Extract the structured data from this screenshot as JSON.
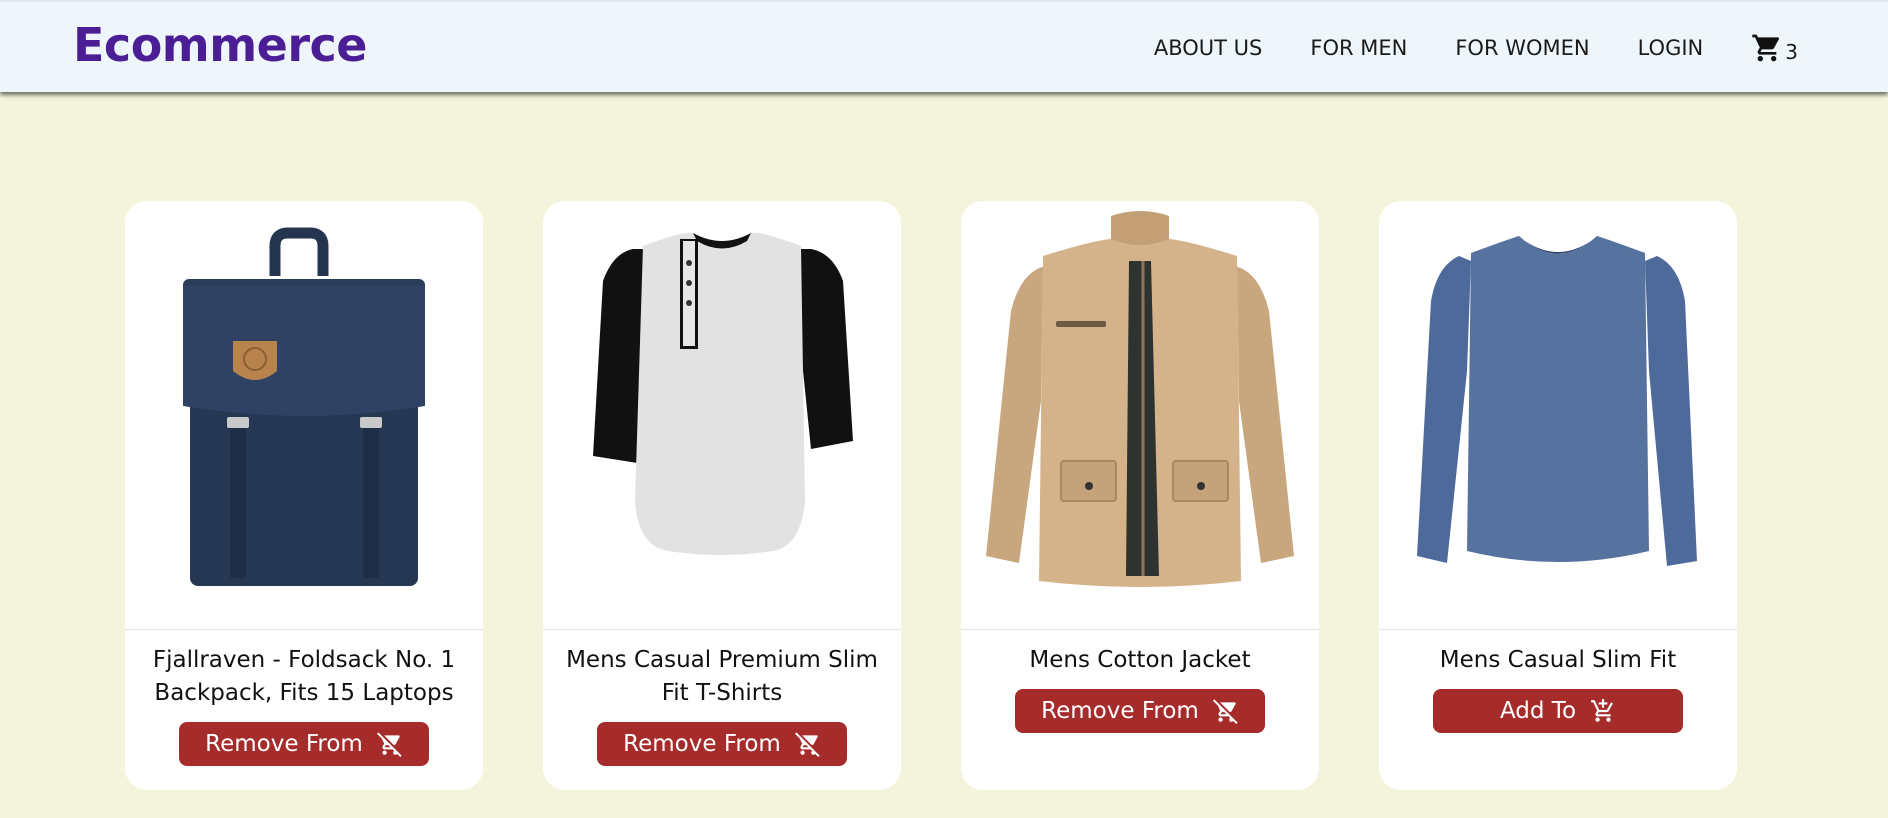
{
  "brand": "Ecommerce",
  "nav": {
    "links": [
      "ABOUT US",
      "FOR MEN",
      "FOR WOMEN",
      "LOGIN"
    ],
    "cart_count": "3",
    "cart_icon": "shopping-cart-icon"
  },
  "colors": {
    "brand": "#4b1e96",
    "button": "#a62b2b",
    "page_bg": "#f4f4dc",
    "nav_bg": "#eef6fc"
  },
  "products": [
    {
      "title": "Fjallraven - Foldsack No. 1 Backpack, Fits 15 Laptops",
      "button_label": "Remove From",
      "button_icon": "remove-shopping-cart-icon"
    },
    {
      "title": "Mens Casual Premium Slim Fit T-Shirts",
      "button_label": "Remove From",
      "button_icon": "remove-shopping-cart-icon"
    },
    {
      "title": "Mens Cotton Jacket",
      "button_label": "Remove From",
      "button_icon": "remove-shopping-cart-icon"
    },
    {
      "title": "Mens Casual Slim Fit",
      "button_label": "Add To",
      "button_icon": "add-shopping-cart-icon"
    }
  ]
}
